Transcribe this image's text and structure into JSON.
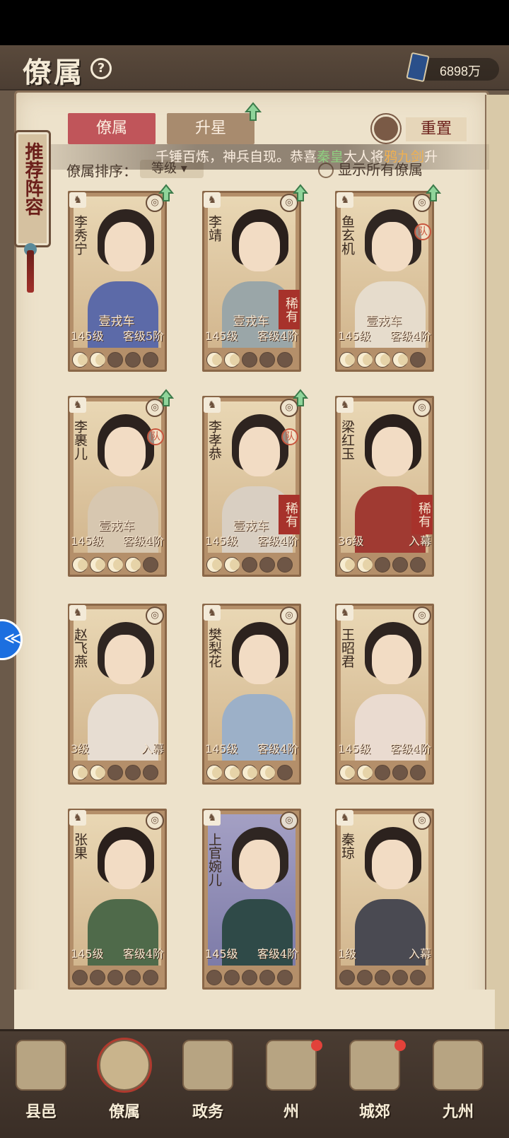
{
  "header": {
    "title": "僚属",
    "help_icon": "question-circle-icon",
    "currency_icon": "blue-book-icon",
    "currency_value": "6898万"
  },
  "recommend": {
    "label": "推荐阵容"
  },
  "tabs": [
    {
      "label": "僚属",
      "active": true
    },
    {
      "label": "升星",
      "active": false
    }
  ],
  "reset": {
    "label": "重置"
  },
  "sort": {
    "label": "僚属排序：",
    "value": "等级"
  },
  "show_all": {
    "label": "显示所有僚属"
  },
  "broadcast": {
    "prefix": "千锤百炼，神兵自现。恭喜",
    "player": "秦皇",
    "middle": "大人将",
    "item": "鸦九剑",
    "tail": "升"
  },
  "cards": [
    {
      "name": "李秀宁",
      "weapon": "壹戎车",
      "level": "145级",
      "rank": "客级5阶",
      "stars_on": 2,
      "rare": "",
      "team": "",
      "upgrade": true
    },
    {
      "name": "李靖",
      "weapon": "壹戎车",
      "level": "145级",
      "rank": "客级4阶",
      "stars_on": 2,
      "rare": "稀有",
      "team": "",
      "upgrade": true
    },
    {
      "name": "鱼玄机",
      "weapon": "壹戎车",
      "level": "145级",
      "rank": "客级4阶",
      "stars_on": 4,
      "rare": "",
      "team": "队",
      "upgrade": true
    },
    {
      "name": "李裹儿",
      "weapon": "壹戎车",
      "level": "145级",
      "rank": "客级4阶",
      "stars_on": 4,
      "rare": "",
      "team": "队",
      "upgrade": true
    },
    {
      "name": "李孝恭",
      "weapon": "壹戎车",
      "level": "145级",
      "rank": "客级4阶",
      "stars_on": 2,
      "rare": "稀有",
      "team": "队",
      "upgrade": true
    },
    {
      "name": "梁红玉",
      "weapon": "",
      "level": "36级",
      "rank": "入幕",
      "stars_on": 2,
      "rare": "稀有",
      "team": "",
      "upgrade": false
    },
    {
      "name": "赵飞燕",
      "weapon": "",
      "level": "3级",
      "rank": "入幕",
      "stars_on": 2,
      "rare": "",
      "team": "",
      "upgrade": false
    },
    {
      "name": "樊梨花",
      "weapon": "",
      "level": "145级",
      "rank": "客级4阶",
      "stars_on": 4,
      "rare": "",
      "team": "",
      "upgrade": false
    },
    {
      "name": "王昭君",
      "weapon": "",
      "level": "145级",
      "rank": "客级4阶",
      "stars_on": 2,
      "rare": "",
      "team": "",
      "upgrade": false
    },
    {
      "name": "张果",
      "weapon": "",
      "level": "145级",
      "rank": "客级4阶",
      "stars_on": 0,
      "rare": "",
      "team": "",
      "upgrade": false
    },
    {
      "name": "上官婉儿",
      "weapon": "",
      "level": "145级",
      "rank": "客级4阶",
      "stars_on": 0,
      "rare": "",
      "team": "",
      "upgrade": false
    },
    {
      "name": "秦琼",
      "weapon": "",
      "level": "1级",
      "rank": "入幕",
      "stars_on": 0,
      "rare": "",
      "team": "",
      "upgrade": false
    }
  ],
  "filters": [
    {
      "icon": "all-diamond-icon",
      "glyph": "◈",
      "active": true
    },
    {
      "icon": "bell-icon",
      "glyph": "♞",
      "active": false
    },
    {
      "icon": "mouse-icon",
      "glyph": "✿",
      "active": false
    },
    {
      "icon": "fan-icon",
      "glyph": "☼",
      "active": false
    },
    {
      "icon": "monkey-icon",
      "glyph": "♛",
      "active": false
    }
  ],
  "nav": [
    {
      "label": "县邑",
      "active": false,
      "dot": false
    },
    {
      "label": "僚属",
      "active": true,
      "dot": false
    },
    {
      "label": "政务",
      "active": false,
      "dot": false
    },
    {
      "label": "州",
      "active": false,
      "dot": true
    },
    {
      "label": "城郊",
      "active": false,
      "dot": true
    },
    {
      "label": "九州",
      "active": false,
      "dot": false
    }
  ]
}
